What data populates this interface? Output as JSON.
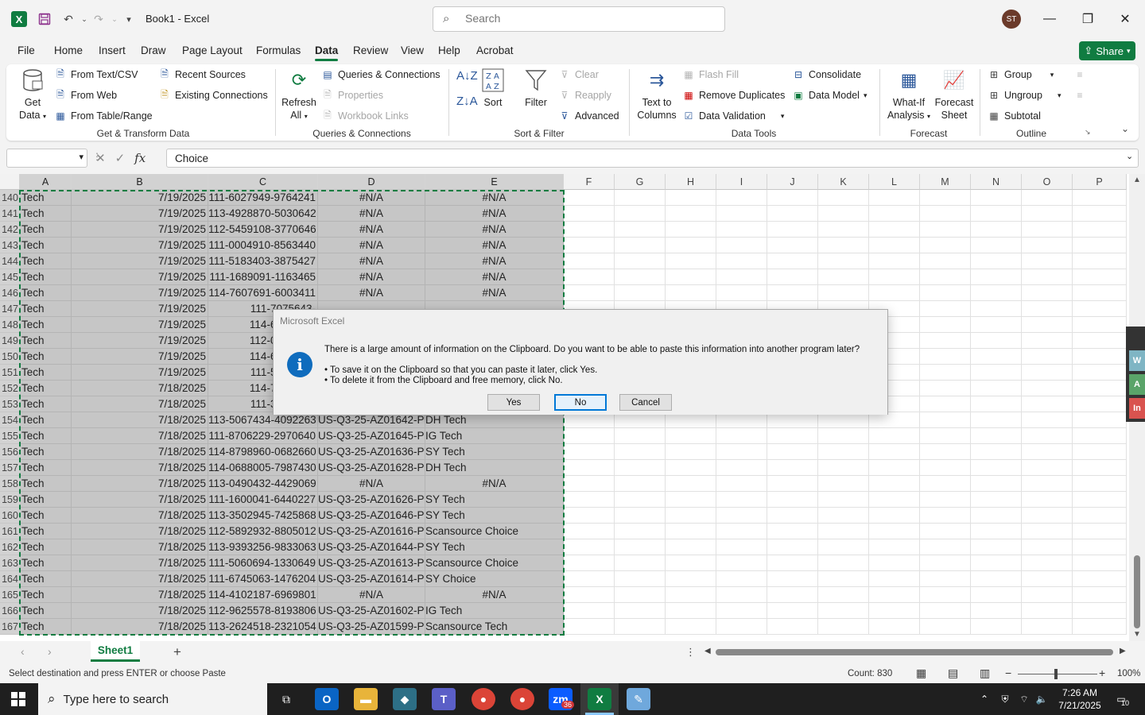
{
  "titlebar": {
    "doc_title": "Book1 - Excel",
    "search_placeholder": "Search",
    "avatar_initials": "ST"
  },
  "menu": {
    "tabs": [
      "File",
      "Home",
      "Insert",
      "Draw",
      "Page Layout",
      "Formulas",
      "Data",
      "Review",
      "View",
      "Help",
      "Acrobat"
    ],
    "active": "Data",
    "share_label": "Share"
  },
  "ribbon": {
    "get_data_line1": "Get",
    "get_data_line2": "Data",
    "from_text_csv": "From Text/CSV",
    "from_web": "From Web",
    "from_table_range": "From Table/Range",
    "recent_sources": "Recent Sources",
    "existing_connections": "Existing Connections",
    "group_get_transform": "Get & Transform Data",
    "refresh_line1": "Refresh",
    "refresh_line2": "All",
    "queries_connections": "Queries & Connections",
    "properties": "Properties",
    "workbook_links": "Workbook Links",
    "group_queries": "Queries & Connections",
    "sort": "Sort",
    "filter": "Filter",
    "clear": "Clear",
    "reapply": "Reapply",
    "advanced": "Advanced",
    "group_sort_filter": "Sort & Filter",
    "text_to_columns_line1": "Text to",
    "text_to_columns_line2": "Columns",
    "flash_fill": "Flash Fill",
    "remove_duplicates": "Remove Duplicates",
    "data_validation": "Data Validation",
    "consolidate": "Consolidate",
    "data_model": "Data Model",
    "group_data_tools": "Data Tools",
    "what_if_line1": "What-If",
    "what_if_line2": "Analysis",
    "forecast_line1": "Forecast",
    "forecast_line2": "Sheet",
    "group_forecast": "Forecast",
    "group_btn": "Group",
    "ungroup_btn": "Ungroup",
    "subtotal": "Subtotal",
    "group_outline": "Outline"
  },
  "formula_bar": {
    "name_box": "",
    "formula": "Choice"
  },
  "columns": [
    "A",
    "B",
    "C",
    "D",
    "E",
    "F",
    "G",
    "H",
    "I",
    "J",
    "K",
    "L",
    "M",
    "N",
    "O",
    "P"
  ],
  "rows": [
    {
      "n": "140",
      "a": "Tech",
      "b": "7/19/2025",
      "c": "111-6027949-9764241",
      "d": "#N/A",
      "e": "#N/A"
    },
    {
      "n": "141",
      "a": "Tech",
      "b": "7/19/2025",
      "c": "113-4928870-5030642",
      "d": "#N/A",
      "e": "#N/A"
    },
    {
      "n": "142",
      "a": "Tech",
      "b": "7/19/2025",
      "c": "112-5459108-3770646",
      "d": "#N/A",
      "e": "#N/A"
    },
    {
      "n": "143",
      "a": "Tech",
      "b": "7/19/2025",
      "c": "111-0004910-8563440",
      "d": "#N/A",
      "e": "#N/A"
    },
    {
      "n": "144",
      "a": "Tech",
      "b": "7/19/2025",
      "c": "111-5183403-3875427",
      "d": "#N/A",
      "e": "#N/A"
    },
    {
      "n": "145",
      "a": "Tech",
      "b": "7/19/2025",
      "c": "111-1689091-1163465",
      "d": "#N/A",
      "e": "#N/A"
    },
    {
      "n": "146",
      "a": "Tech",
      "b": "7/19/2025",
      "c": "114-7607691-6003411",
      "d": "#N/A",
      "e": "#N/A"
    },
    {
      "n": "147",
      "a": "Tech",
      "b": "7/19/2025",
      "c": "111-7075643-",
      "d": "",
      "e": ""
    },
    {
      "n": "148",
      "a": "Tech",
      "b": "7/19/2025",
      "c": "114-6241036-",
      "d": "",
      "e": ""
    },
    {
      "n": "149",
      "a": "Tech",
      "b": "7/19/2025",
      "c": "112-0684239-",
      "d": "",
      "e": ""
    },
    {
      "n": "150",
      "a": "Tech",
      "b": "7/19/2025",
      "c": "114-6540000-",
      "d": "",
      "e": ""
    },
    {
      "n": "151",
      "a": "Tech",
      "b": "7/19/2025",
      "c": "111-5787350-",
      "d": "",
      "e": ""
    },
    {
      "n": "152",
      "a": "Tech",
      "b": "7/18/2025",
      "c": "114-7991710-",
      "d": "",
      "e": ""
    },
    {
      "n": "153",
      "a": "Tech",
      "b": "7/18/2025",
      "c": "111-3696080-",
      "d": "",
      "e": ""
    },
    {
      "n": "154",
      "a": "Tech",
      "b": "7/18/2025",
      "c": "113-5067434-4092263",
      "d": "US-Q3-25-AZ01642-P",
      "e": "DH Tech"
    },
    {
      "n": "155",
      "a": "Tech",
      "b": "7/18/2025",
      "c": "111-8706229-2970640",
      "d": "US-Q3-25-AZ01645-P",
      "e": "IG Tech"
    },
    {
      "n": "156",
      "a": "Tech",
      "b": "7/18/2025",
      "c": "114-8798960-0682660",
      "d": "US-Q3-25-AZ01636-P",
      "e": "SY Tech"
    },
    {
      "n": "157",
      "a": "Tech",
      "b": "7/18/2025",
      "c": "114-0688005-7987430",
      "d": "US-Q3-25-AZ01628-P",
      "e": "DH Tech"
    },
    {
      "n": "158",
      "a": "Tech",
      "b": "7/18/2025",
      "c": "113-0490432-4429069",
      "d": "#N/A",
      "e": "#N/A"
    },
    {
      "n": "159",
      "a": "Tech",
      "b": "7/18/2025",
      "c": "111-1600041-6440227",
      "d": "US-Q3-25-AZ01626-P",
      "e": "SY Tech"
    },
    {
      "n": "160",
      "a": "Tech",
      "b": "7/18/2025",
      "c": "113-3502945-7425868",
      "d": "US-Q3-25-AZ01646-P",
      "e": "SY Tech"
    },
    {
      "n": "161",
      "a": "Tech",
      "b": "7/18/2025",
      "c": "112-5892932-8805012",
      "d": "US-Q3-25-AZ01616-P",
      "e": "Scansource Choice"
    },
    {
      "n": "162",
      "a": "Tech",
      "b": "7/18/2025",
      "c": "113-9393256-9833063",
      "d": "US-Q3-25-AZ01644-P",
      "e": "SY Tech"
    },
    {
      "n": "163",
      "a": "Tech",
      "b": "7/18/2025",
      "c": "111-5060694-1330649",
      "d": "US-Q3-25-AZ01613-P",
      "e": "Scansource Choice"
    },
    {
      "n": "164",
      "a": "Tech",
      "b": "7/18/2025",
      "c": "111-6745063-1476204",
      "d": "US-Q3-25-AZ01614-P",
      "e": "SY Choice"
    },
    {
      "n": "165",
      "a": "Tech",
      "b": "7/18/2025",
      "c": "114-4102187-6969801",
      "d": "#N/A",
      "e": "#N/A"
    },
    {
      "n": "166",
      "a": "Tech",
      "b": "7/18/2025",
      "c": "112-9625578-8193806",
      "d": "US-Q3-25-AZ01602-P",
      "e": "IG Tech"
    },
    {
      "n": "167",
      "a": "Tech",
      "b": "7/18/2025",
      "c": "113-2624518-2321054",
      "d": "US-Q3-25-AZ01599-P",
      "e": "Scansource Tech"
    }
  ],
  "side_tabs": [
    "W",
    "A",
    "In"
  ],
  "sheet_tabs": {
    "active": "Sheet1",
    "add": "+"
  },
  "status": {
    "message": "Select destination and press ENTER or choose Paste",
    "count": "Count: 830",
    "zoom": "100%"
  },
  "dialog": {
    "title": "Microsoft Excel",
    "message": "There is a large amount of information on the Clipboard. Do you want to be able to paste this information into another program later?",
    "bullet1": "• To save it on the Clipboard so that you can paste it later, click Yes.",
    "bullet2": "• To delete it from the Clipboard and free memory, click No.",
    "yes": "Yes",
    "no": "No",
    "cancel": "Cancel"
  },
  "taskbar": {
    "search_placeholder": "Type here to search",
    "time": "7:26 AM",
    "date": "7/21/2025",
    "notification_count": "10",
    "zoom_badge": "36"
  },
  "colors": {
    "excel_green": "#107c41",
    "selection_gray": "#c6c6c6",
    "dialog_blue": "#0f6cbd"
  }
}
